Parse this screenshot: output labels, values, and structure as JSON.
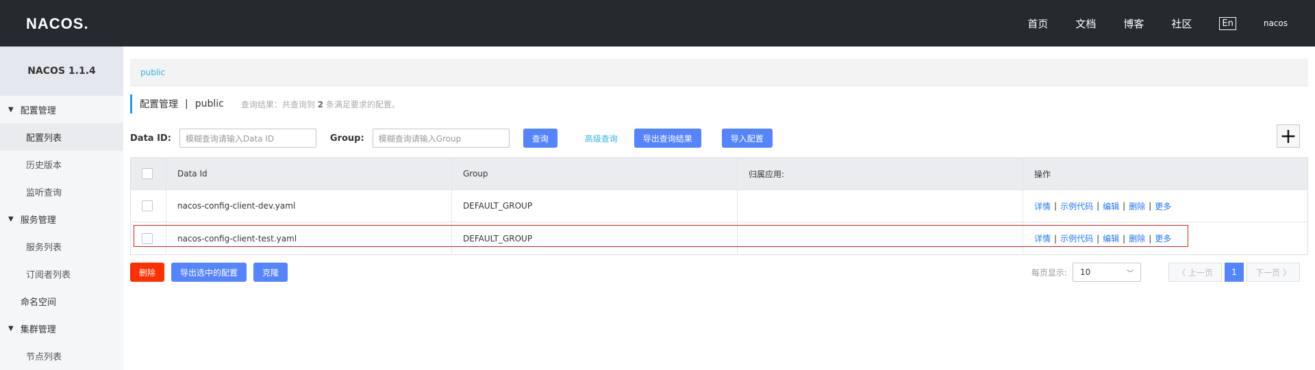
{
  "header": {
    "logo": "NACOS.",
    "nav": [
      "首页",
      "文档",
      "博客",
      "社区"
    ],
    "lang": "En",
    "user": "nacos"
  },
  "sidebar": {
    "title": "NACOS 1.1.4",
    "groups": [
      {
        "label": "配置管理",
        "items": [
          "配置列表",
          "历史版本",
          "监听查询"
        ]
      },
      {
        "label": "服务管理",
        "items": [
          "服务列表",
          "订阅者列表"
        ]
      }
    ],
    "namespace": "命名空间",
    "cluster": {
      "label": "集群管理",
      "items": [
        "节点列表"
      ]
    }
  },
  "main": {
    "namespace_link": "public",
    "page_title": "配置管理",
    "separator": "|",
    "namespace_name": "public",
    "result_prefix": "查询结果：共查询到",
    "result_count": "2",
    "result_suffix": "条满足要求的配置。",
    "search": {
      "data_id_label": "Data ID:",
      "data_id_placeholder": "模糊查询请输入Data ID",
      "group_label": "Group:",
      "group_placeholder": "模糊查询请输入Group",
      "query_button": "查询",
      "advanced": "高级查询",
      "export_result": "导出查询结果",
      "import": "导入配置",
      "add": "+"
    },
    "table": {
      "headers": [
        "Data Id",
        "Group",
        "归属应用:",
        "操作"
      ],
      "rows": [
        {
          "data_id": "nacos-config-client-dev.yaml",
          "group": "DEFAULT_GROUP",
          "app": ""
        },
        {
          "data_id": "nacos-config-client-test.yaml",
          "group": "DEFAULT_GROUP",
          "app": ""
        }
      ],
      "ops": [
        "详情",
        "示例代码",
        "编辑",
        "删除",
        "更多"
      ]
    },
    "bottom": {
      "delete": "删除",
      "export_selected": "导出选中的配置",
      "clone": "克隆",
      "page_size_label": "每页显示:",
      "page_size": "10",
      "prev": "上一页",
      "current_page": "1",
      "next": "下一页"
    }
  }
}
